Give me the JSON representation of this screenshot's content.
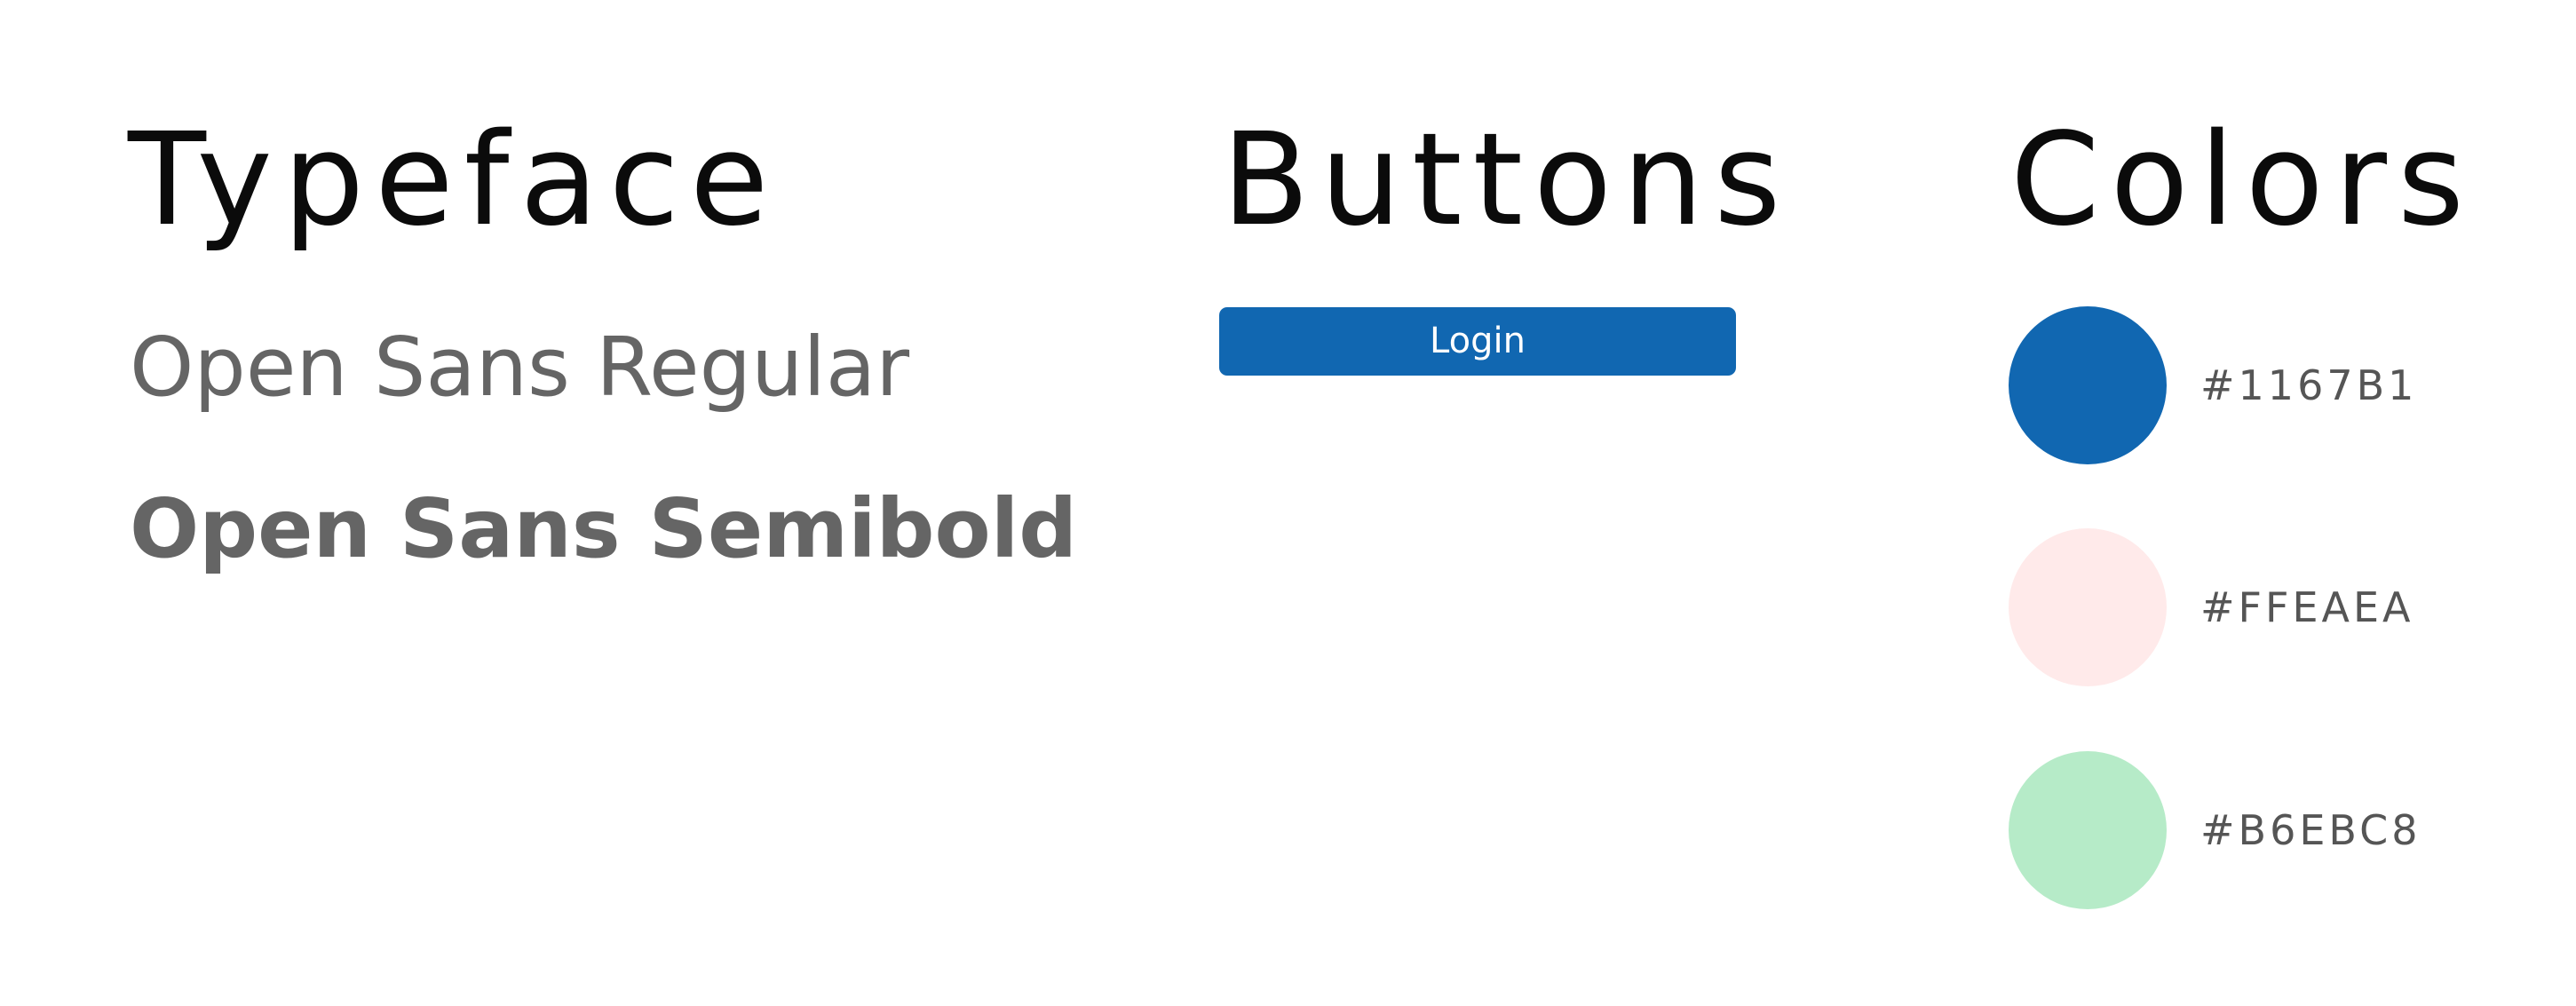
{
  "typeface": {
    "heading": "Typeface",
    "samples": [
      {
        "label": "Open Sans Regular"
      },
      {
        "label": "Open Sans Semibold"
      }
    ]
  },
  "buttons": {
    "heading": "Buttons",
    "login_label": "Login",
    "login_color": "#1167B1"
  },
  "colors": {
    "heading": "Colors",
    "swatches": [
      {
        "hex": "#1167B1"
      },
      {
        "hex": "#FFEAEA"
      },
      {
        "hex": "#B6EBC8"
      }
    ]
  }
}
